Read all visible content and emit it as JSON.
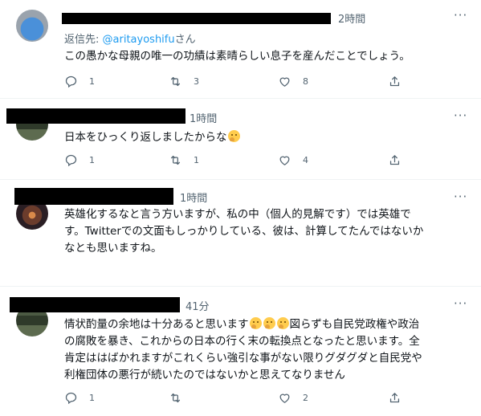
{
  "tweets": [
    {
      "time": "2時間",
      "reply_prefix": "返信先:",
      "reply_handle": "@aritayoshifu",
      "reply_suffix": "さん",
      "text": "この愚かな母親の唯一の功績は素晴らしい息子を産んだことでしょう。",
      "reply_count": "1",
      "retweet_count": "3",
      "like_count": "8"
    },
    {
      "time": "1時間",
      "text": "日本をひっくり返しましたからな",
      "reply_count": "1",
      "retweet_count": "1",
      "like_count": "4"
    },
    {
      "time": "1時間",
      "text_line1": "英雄化するなと言う方いますが、私の中（個人的見解です）では英雄で",
      "text_line2": "す。Twitterでの文面もしっかりしている、彼は、計算してたんではないか",
      "text_line3": "なとも思いますね。"
    },
    {
      "time": "41分",
      "text_line1a": "情状酌量の余地は十分あると思います",
      "text_line1b": "図らずも自民党政権や政治",
      "text_line2": "の腐敗を暴き、これからの日本の行く末の転換点となったと思います。全",
      "text_line3": "肯定ははばかれますがこれくらい強引な事がない限りグダグダと自民党や",
      "text_line4": "利権団体の悪行が続いたのではないかと思えてなりません",
      "reply_count": "1",
      "retweet_count": "",
      "like_count": "2"
    }
  ],
  "icons": [
    "reply-icon",
    "retweet-icon",
    "like-icon",
    "share-icon",
    "more-icon",
    "thinking-face-emoji"
  ],
  "colors": {
    "link": "#1d9bf0",
    "muted": "#536471",
    "text": "#0f1419"
  }
}
